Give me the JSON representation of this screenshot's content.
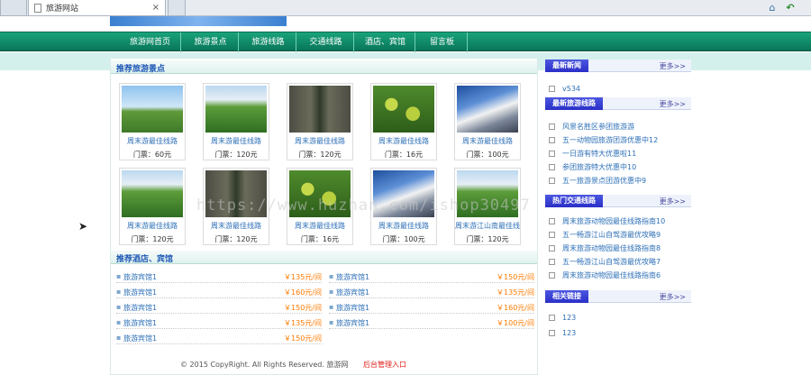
{
  "browser": {
    "tab_title": "旅游网站",
    "tab_close": "×",
    "home_icon": "home-icon",
    "back_icon": "back-arrow-icon"
  },
  "nav": {
    "items": [
      "旅游网首页",
      "旅游景点",
      "旅游线路",
      "交通线路",
      "酒店、宾馆",
      "留言板"
    ]
  },
  "spots": {
    "title": "推荐旅游景点",
    "items": [
      {
        "name": "周末游最佳线路",
        "price": "门票：60元",
        "scene": "pavilion"
      },
      {
        "name": "周末游最佳线路",
        "price": "门票：120元",
        "scene": "lotus"
      },
      {
        "name": "周末游最佳线路",
        "price": "门票：120元",
        "scene": "castle"
      },
      {
        "name": "周末游最佳线路",
        "price": "门票：16元",
        "scene": "fruit"
      },
      {
        "name": "周末游最佳线路",
        "price": "门票：100元",
        "scene": "mountain"
      },
      {
        "name": "周末游最佳线路",
        "price": "门票：120元",
        "scene": "lotus"
      },
      {
        "name": "周末游最佳线路",
        "price": "门票：120元",
        "scene": "castle"
      },
      {
        "name": "周末游最佳线路",
        "price": "门票：16元",
        "scene": "fruit"
      },
      {
        "name": "周末游最佳线路",
        "price": "门票：100元",
        "scene": "mountain"
      },
      {
        "name": "周末游江山南最佳线路",
        "price": "门票：120元",
        "scene": "lotus"
      }
    ]
  },
  "hotels": {
    "title": "推荐酒店、宾馆",
    "items": [
      {
        "name": "旅游宾馆1",
        "price": "￥135元/间"
      },
      {
        "name": "旅游宾馆1",
        "price": "￥150元/间"
      },
      {
        "name": "旅游宾馆1",
        "price": "￥160元/间"
      },
      {
        "name": "旅游宾馆1",
        "price": "￥135元/间"
      },
      {
        "name": "旅游宾馆1",
        "price": "￥150元/间"
      },
      {
        "name": "旅游宾馆1",
        "price": "￥160元/间"
      },
      {
        "name": "旅游宾馆1",
        "price": "￥135元/间"
      },
      {
        "name": "旅游宾馆1",
        "price": "￥100元/间"
      },
      {
        "name": "旅游宾馆1",
        "price": "￥150元/间"
      }
    ]
  },
  "footer": {
    "copyright": "© 2015 CopyRight. All Rights Reserved. 旅游网",
    "admin_link": "后台管理入口"
  },
  "sidebar": {
    "news": {
      "title": "最新新闻",
      "more": "更多>>",
      "items": [
        "v534"
      ]
    },
    "routes": {
      "title": "最新旅游线路",
      "more": "更多>>",
      "items": [
        "风景名胜区参团旅游游",
        "五一动物园旅游团游优惠中12",
        "一日游有特大优惠啦11",
        "参团旅游特大优惠中10",
        "五一旅游景点团游优惠中9"
      ]
    },
    "traffic": {
      "title": "热门交通线路",
      "more": "更多>>",
      "items": [
        "周末旅游动物园最佳线路指南10",
        "五一畅游江山自驾游最优攻略9",
        "周末旅游动物园最佳线路指南8",
        "五一畅游江山自驾游最优攻略7",
        "周末旅游动物园最佳线路指南6"
      ]
    },
    "links": {
      "title": "相关链接",
      "more": "更多>>",
      "items": [
        "123",
        "123"
      ]
    }
  },
  "watermark": "https://www.huzhan.com/ishop30497"
}
